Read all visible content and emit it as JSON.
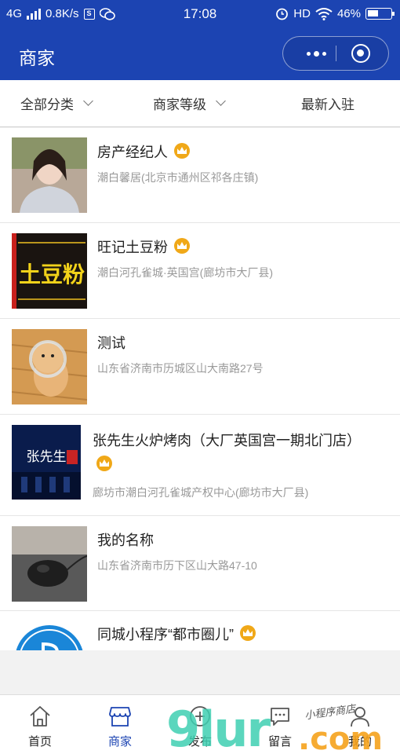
{
  "status_bar": {
    "network": "4G",
    "speed": "0.8K/s",
    "s_icon_label": "S",
    "time": "17:08",
    "hd": "HD",
    "battery": "46%"
  },
  "nav": {
    "title": "商家",
    "bg_color": "#1c44b2"
  },
  "filters": {
    "all_categories": "全部分类",
    "merchant_level": "商家等级",
    "newest": "最新入驻"
  },
  "merchants": [
    {
      "name": "房产经纪人",
      "address": "潮白馨居(北京市通州区祁各庄镇)",
      "crown": true
    },
    {
      "name": "旺记土豆粉",
      "address": "潮白河孔雀城·英国宫(廊坊市大厂县)",
      "crown": true,
      "logo_text": "土豆粉"
    },
    {
      "name": "测试",
      "address": "山东省济南市历城区山大南路27号",
      "crown": false
    },
    {
      "name": "张先生火炉烤肉（大厂英国宫一期北门店）",
      "address": "廊坊市潮白河孔雀城产权中心(廊坊市大厂县)",
      "crown": true,
      "logo_text": "张先生"
    },
    {
      "name": "我的名称",
      "address": "山东省济南市历下区山大路47-10",
      "crown": false
    },
    {
      "name": "同城小程序“都市圈儿”",
      "address": "",
      "crown": true
    }
  ],
  "tabs": [
    {
      "label": "首页",
      "icon": "home-icon"
    },
    {
      "label": "商家",
      "icon": "store-icon",
      "active": true
    },
    {
      "label": "发布",
      "icon": "plus-icon"
    },
    {
      "label": "留言",
      "icon": "message-icon"
    },
    {
      "label": "我的",
      "icon": "user-icon"
    }
  ],
  "watermark": {
    "main": "9lur",
    "suffix": ".com",
    "tag": "小程序商店"
  }
}
